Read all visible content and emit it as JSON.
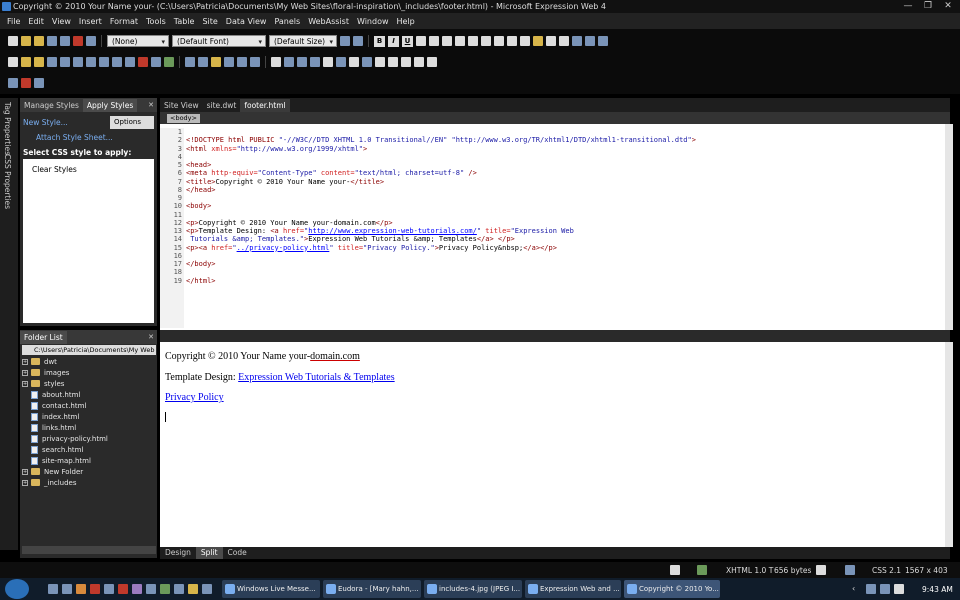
{
  "window": {
    "title": "Copyright © 2010 Your Name your- (C:\\Users\\Patricia\\Documents\\My Web Sites\\floral-inspiration\\_includes\\footer.html) - Microsoft Expression Web 4",
    "min": "—",
    "max": "❐",
    "close": "✕"
  },
  "menu": [
    "File",
    "Edit",
    "View",
    "Insert",
    "Format",
    "Tools",
    "Table",
    "Site",
    "Data View",
    "Panels",
    "WebAssist",
    "Window",
    "Help"
  ],
  "toolbar": {
    "style_combo": "(None)",
    "font_combo": "(Default Font)",
    "size_combo": "(Default Size)",
    "bold": "B",
    "italic": "I",
    "underline": "U"
  },
  "left_tabs": {
    "tag_properties": "Tag Properties",
    "css_properties": "CSS Properties"
  },
  "styles_panel": {
    "tab1": "Manage Styles",
    "tab2": "Apply Styles",
    "new_style": "New Style...",
    "options": "Options",
    "attach": "Attach Style Sheet...",
    "select_label": "Select CSS style to apply:",
    "clear_styles": "Clear Styles"
  },
  "folder_panel": {
    "tab": "Folder List",
    "root": "C:\\Users\\Patricia\\Documents\\My Web Sites",
    "items": [
      {
        "name": "dwt",
        "type": "folder",
        "exp": "+"
      },
      {
        "name": "images",
        "type": "folder",
        "exp": "+"
      },
      {
        "name": "styles",
        "type": "folder",
        "exp": "+"
      },
      {
        "name": "about.html",
        "type": "file"
      },
      {
        "name": "contact.html",
        "type": "file"
      },
      {
        "name": "index.html",
        "type": "file"
      },
      {
        "name": "links.html",
        "type": "file"
      },
      {
        "name": "privacy-policy.html",
        "type": "file"
      },
      {
        "name": "search.html",
        "type": "file"
      },
      {
        "name": "site-map.html",
        "type": "file"
      },
      {
        "name": "New Folder",
        "type": "folder",
        "exp": "+"
      },
      {
        "name": "_includes",
        "type": "folder",
        "exp": "+"
      }
    ]
  },
  "doc_tabs": [
    "Site View",
    "site.dwt",
    "footer.html"
  ],
  "tag_selector": "<body>",
  "code_line_numbers": [
    "1",
    "2",
    "3",
    "4",
    "5",
    "6",
    "7",
    "8",
    "9",
    "10",
    "11",
    "12",
    "13",
    "14",
    "15",
    "16",
    "17",
    "18",
    "19"
  ],
  "code": {
    "l1a": "<!DOCTYPE html PUBLIC ",
    "l1b": "\"-//W3C//DTD XHTML 1.0 Transitional//EN\" \"http://www.w3.org/TR/xhtml1/DTD/xhtml1-transitional.dtd\"",
    "l1c": ">",
    "l2a": "<html ",
    "l2b": "xmlns=",
    "l2c": "\"http://www.w3.org/1999/xhtml\"",
    "l2d": ">",
    "l4": "<head>",
    "l5a": "<meta ",
    "l5b": "http-equiv=",
    "l5c": "\"Content-Type\" ",
    "l5d": "content=",
    "l5e": "\"text/html; charset=utf-8\" ",
    "l5f": "/>",
    "l6a": "<title>",
    "l6b": "Copyright © 2010 Your Name your-",
    "l6c": "</title>",
    "l7": "</head>",
    "l9": "<body>",
    "l11a": "<p>",
    "l11b": "Copyright © 2010 Your Name your-domain.com",
    "l11c": "</p>",
    "l12a": "<p>",
    "l12b": "Template Design: ",
    "l12c": "<a ",
    "l12d": "href=",
    "l12e": "\"",
    "l12f": "http://www.expression-web-tutorials.com/",
    "l12g": "\" ",
    "l12h": "title=",
    "l12i": "\"Expression Web",
    "l13a": "Tutorials &amp; Templates.\"",
    "l13b": ">",
    "l13c": "Expression Web Tutorials &amp; Templates",
    "l13d": "</a> </p>",
    "l14a": "<p><a ",
    "l14b": "href=",
    "l14c": "\"",
    "l14d": "../privacy-policy.html",
    "l14e": "\" ",
    "l14f": "title=",
    "l14g": "\"Privacy Policy.\"",
    "l14h": ">",
    "l14i": "Privacy Policy&nbsp;",
    "l14j": "</a></p>",
    "l16": "</body>",
    "l18": "</html>"
  },
  "design": {
    "line1a": "Copyright © 2010 Your Name your-",
    "line1b": "domain.com",
    "line2a": "Template Design: ",
    "line2b": "Expression Web Tutorials & Templates",
    "line3": "Privacy Policy "
  },
  "view_tabs": [
    "Design",
    "Split",
    "Code"
  ],
  "status": {
    "doctype": "XHTML 1.0 T",
    "size": "656 bytes",
    "css": "CSS 2.1",
    "dims": "1567 x 403"
  },
  "taskbar": {
    "items": [
      "Windows Live Messe...",
      "Eudora - [Mary hahn,...",
      "includes-4.jpg (JPEG I...",
      "Expression Web and ...",
      "Copyright © 2010 Yo..."
    ],
    "time": "9:43 AM"
  }
}
